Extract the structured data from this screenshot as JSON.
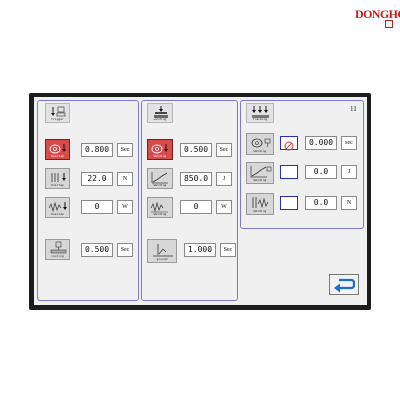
{
  "brand": {
    "logo_text": "DONGHO"
  },
  "page_indicator": "11",
  "trigger_panel": {
    "header": {
      "icon": "trigger-icon",
      "label": "trigger"
    },
    "rows": [
      {
        "icon": "overlap-circles-icon",
        "icon_label": "Overlap",
        "value": "0.800",
        "unit": "Sec",
        "selected": true
      },
      {
        "icon": "pressure-icon",
        "icon_label": "Overlap",
        "value": "22.0",
        "unit": "N",
        "selected": false
      },
      {
        "icon": "amplitude-wave-icon",
        "icon_label": "Overlap",
        "value": "0",
        "unit": "W",
        "selected": false
      },
      {
        "icon": "cooling-icon",
        "icon_label": "cooling",
        "value": "0.500",
        "unit": "Sec",
        "selected": false
      }
    ]
  },
  "welding_panel": {
    "header": {
      "icon": "welding-icon",
      "label": "welding"
    },
    "rows": [
      {
        "icon": "overlap-circles-icon",
        "icon_label": "Welding",
        "value": "0.500",
        "unit": "Sec",
        "selected": true
      },
      {
        "icon": "energy-graph-icon",
        "icon_label": "Welding",
        "value": "850.0",
        "unit": "J",
        "selected": false
      },
      {
        "icon": "amplitude-wave-icon",
        "icon_label": "Welding",
        "value": "0",
        "unit": "W",
        "selected": false
      },
      {
        "icon": "ground-icon",
        "icon_label": "ground",
        "value": "1.000",
        "unit": "Sec",
        "selected": false
      }
    ]
  },
  "tracking_panel": {
    "header": {
      "icon": "tracking-icon",
      "label": "Tracking"
    },
    "rows": [
      {
        "icon": "overlap-circles-icon",
        "icon_label": "Welding",
        "toggle": "prohibited",
        "value": "0.000",
        "unit": "sec"
      },
      {
        "icon": "energy-graph-icon",
        "icon_label": "Welding",
        "toggle": "empty",
        "value": "0.0",
        "unit": "J"
      },
      {
        "icon": "amplitude-wave-icon",
        "icon_label": "Welding",
        "toggle": "empty",
        "value": "0.0",
        "unit": "N"
      }
    ]
  },
  "back_button": {
    "icon": "return-arrow-icon"
  },
  "colors": {
    "panel_border": "#7b7bd6",
    "selected_icon": "#d94a4a",
    "toggle_border": "#2c2ccc",
    "back_arrow": "#1a6fd6",
    "brand": "#c41e1e"
  }
}
